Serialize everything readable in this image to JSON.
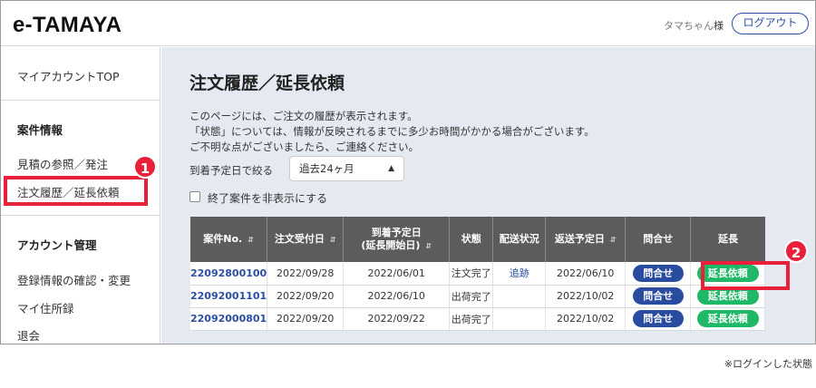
{
  "header": {
    "logo": "e-TAMAYA",
    "user_name": "タマちゃん",
    "user_suffix": "様",
    "logout_label": "ログアウト"
  },
  "sidebar": {
    "top_link": "マイアカウントTOP",
    "section1_title": "案件情報",
    "section1_items": [
      "見積の参照／発注",
      "注文履歴／延長依頼"
    ],
    "section2_title": "アカウント管理",
    "section2_items": [
      "登録情報の確認・変更",
      "マイ住所録",
      "退会"
    ]
  },
  "badges": [
    "1",
    "2"
  ],
  "main": {
    "title": "注文履歴／延長依頼",
    "desc_lines": [
      "このページには、ご注文の履歴が表示されます。",
      "「状態」については、情報が反映されるまでに多少お時間がかかる場合がございます。",
      "ご不明な点がございましたら、ご連絡ください。"
    ],
    "filter_label": "到着予定日で絞る",
    "filter_value": "過去24ヶ月",
    "checkbox_label": "終了案件を非表示にする"
  },
  "table": {
    "headers": [
      "案件No.",
      "注文受付日",
      "到着予定日",
      "(延長開始日)",
      "状態",
      "配送状況",
      "返送予定日",
      "問合せ",
      "延長"
    ],
    "rows": [
      {
        "id": "22092800100",
        "order_date": "2022/09/28",
        "arrival": "2022/06/01",
        "status": "注文完了",
        "delivery": "追跡",
        "return": "2022/06/10",
        "inquiry": "問合せ",
        "extend": "延長依頼"
      },
      {
        "id": "22092001101",
        "order_date": "2022/09/20",
        "arrival": "2022/06/10",
        "status": "出荷完了",
        "delivery": "",
        "return": "2022/10/02",
        "inquiry": "問合せ",
        "extend": "延長依頼"
      },
      {
        "id": "22092000801",
        "order_date": "2022/09/20",
        "arrival": "2022/09/22",
        "status": "出荷完了",
        "delivery": "",
        "return": "2022/10/02",
        "inquiry": "問合せ",
        "extend": "延長依頼"
      }
    ]
  },
  "footnote": "※ログインした状態",
  "colors": {
    "accent": "#2b4fa0",
    "extend_green": "#1fb866",
    "highlight_red": "#e8203a"
  }
}
